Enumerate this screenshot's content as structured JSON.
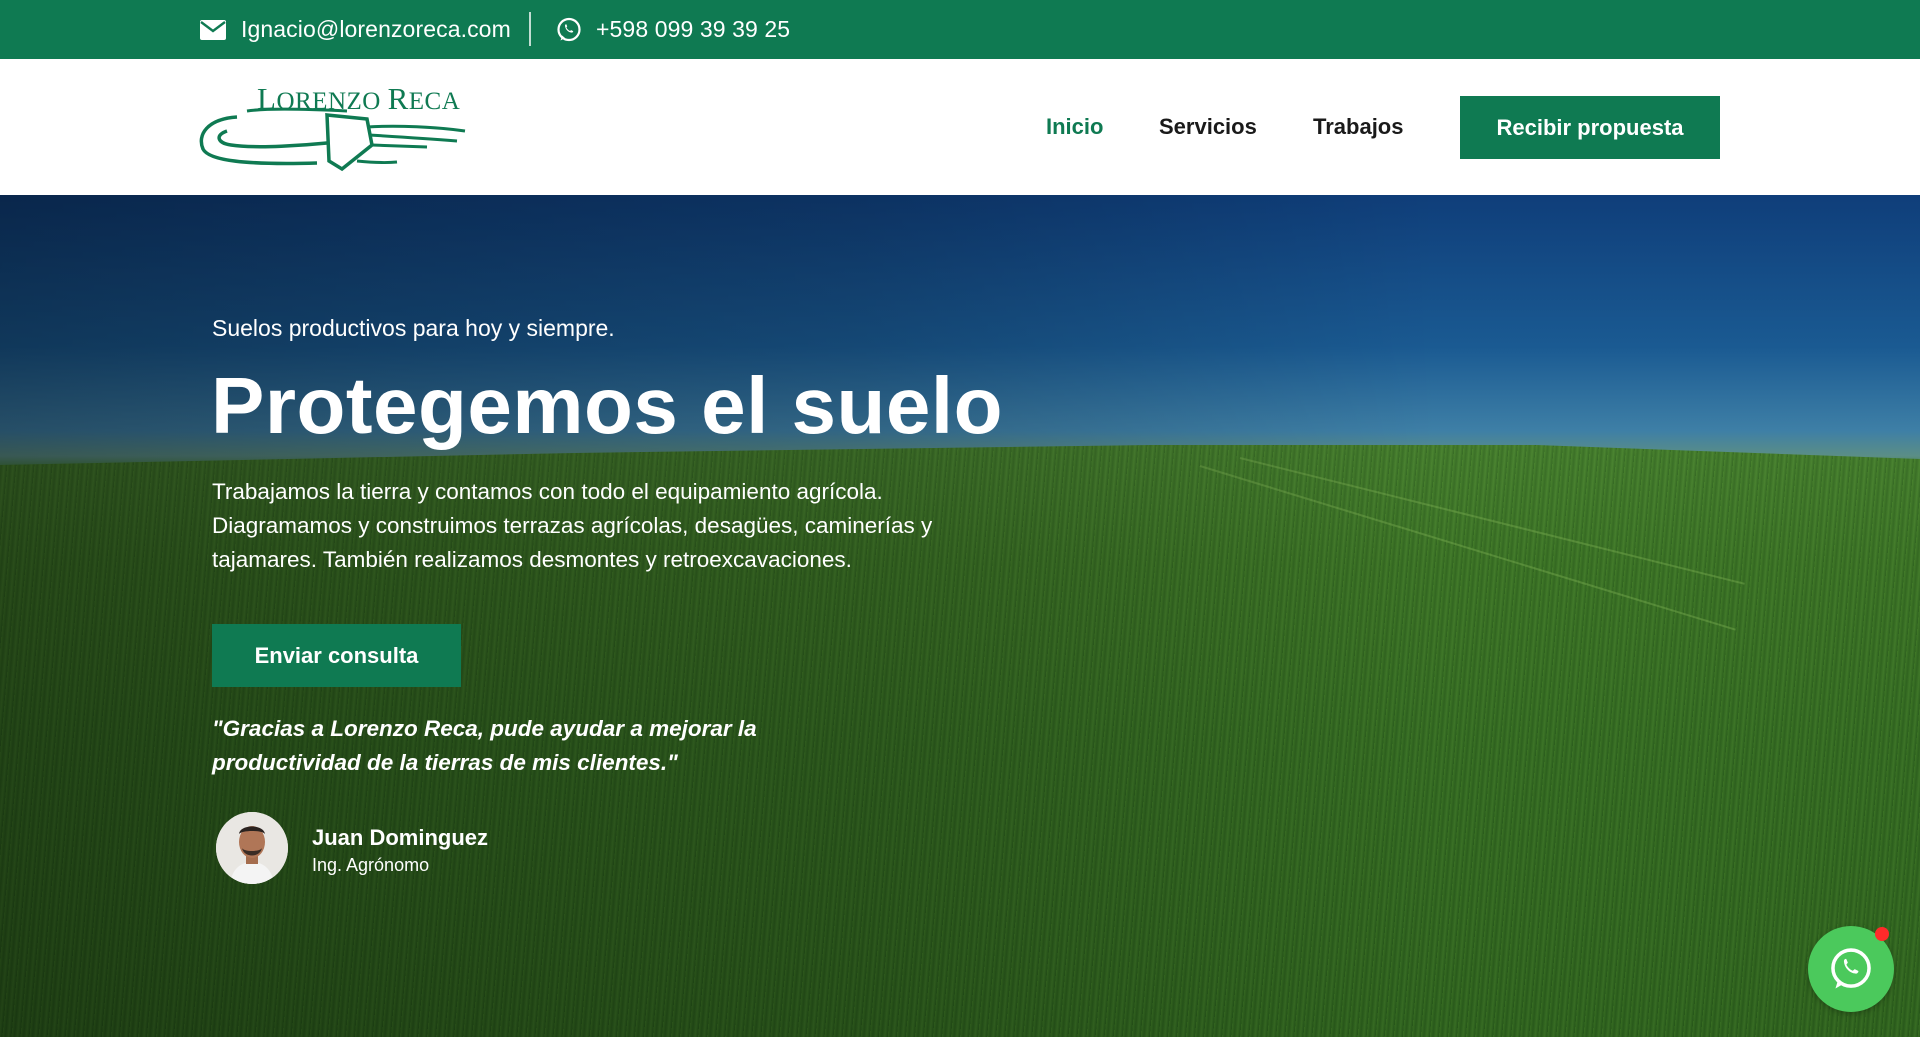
{
  "topbar": {
    "email": "Ignacio@lorenzoreca.com",
    "phone": "+598 099 39 39 25",
    "email_icon": "envelope-icon",
    "phone_icon": "whatsapp-icon"
  },
  "brand": {
    "name_first_initial": "L",
    "name_first_rest": "ORENZO ",
    "name_last_initial": "R",
    "name_last_rest": "ECA"
  },
  "nav": {
    "items": [
      {
        "label": "Inicio",
        "active": true
      },
      {
        "label": "Servicios",
        "active": false
      },
      {
        "label": "Trabajos",
        "active": false
      }
    ],
    "cta_label": "Recibir propuesta"
  },
  "hero": {
    "subtitle": "Suelos productivos para hoy y siempre.",
    "title": "Protegemos el suelo",
    "description": "Trabajamos la tierra y contamos con todo el equipamiento agrícola. Diagramamos y construimos terrazas agrícolas, desagües, caminerías y tajamares. También realizamos desmontes y retroexcavaciones.",
    "cta_label": "Enviar consulta",
    "quote": "\"Gracias a Lorenzo Reca, pude ayudar a mejorar la productividad de la tierras de mis clientes.\"",
    "testimonial": {
      "name": "Juan Dominguez",
      "role": "Ing. Agrónomo"
    }
  },
  "floating": {
    "icon": "whatsapp-icon",
    "has_notification": true
  },
  "colors": {
    "brand_green": "#0f7a52",
    "whatsapp_green": "#4bc95c",
    "notification_red": "#ff2a2a"
  }
}
